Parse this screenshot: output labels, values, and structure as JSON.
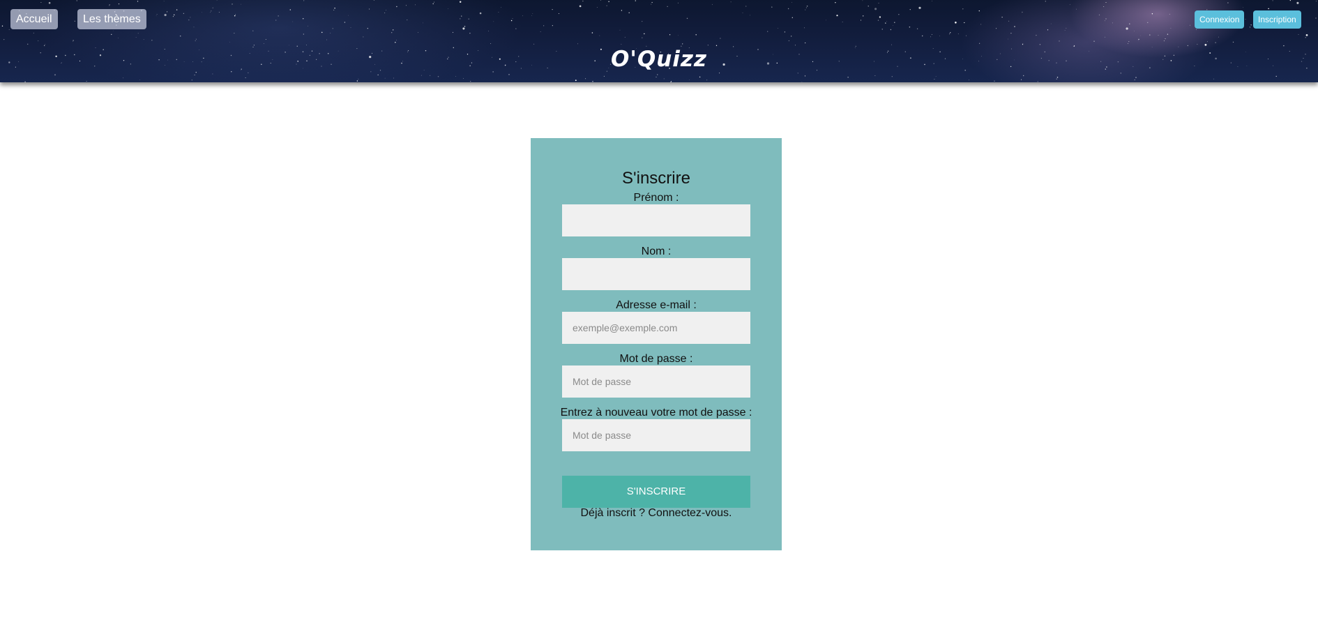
{
  "header": {
    "brand": "O'Quizz",
    "nav": {
      "home_label": "Accueil",
      "themes_label": "Les thèmes"
    },
    "auth": {
      "login_label": "Connexion",
      "register_label": "Inscription"
    }
  },
  "form": {
    "title": "S'inscrire",
    "fields": {
      "firstname": {
        "label": "Prénom :",
        "placeholder": "",
        "value": ""
      },
      "lastname": {
        "label": "Nom :",
        "placeholder": "",
        "value": ""
      },
      "email": {
        "label": "Adresse e-mail :",
        "placeholder": "exemple@exemple.com",
        "value": ""
      },
      "password": {
        "label": "Mot de passe :",
        "placeholder": "Mot de passe",
        "value": ""
      },
      "password_confirm": {
        "label": "Entrez à nouveau votre mot de passe :",
        "placeholder": "Mot de passe",
        "value": ""
      }
    },
    "submit_label": "S'inscrire",
    "login_link_text": "Déjà inscrit ? Connectez-vous."
  },
  "colors": {
    "card_background": "#7fbcbd",
    "submit_background": "#4db3a8",
    "auth_button_background": "#5bbfdc",
    "input_background": "#f0f0f0"
  }
}
